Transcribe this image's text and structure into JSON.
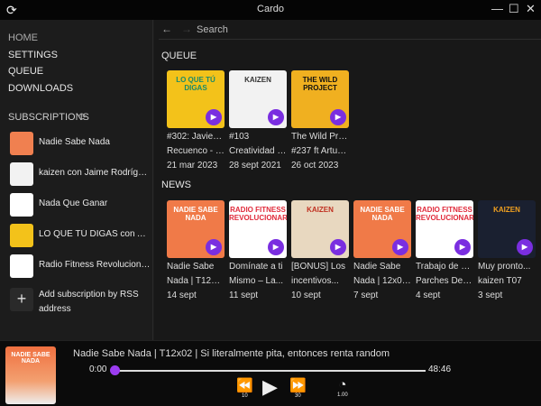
{
  "window": {
    "title": "Cardo",
    "sync_icon": "sync-icon"
  },
  "nav": [
    "HOME",
    "SETTINGS",
    "QUEUE",
    "DOWNLOADS"
  ],
  "subscriptions": {
    "heading": "SUBSCRIPTIONS",
    "items": [
      {
        "name": "Nadie Sabe Nada",
        "color": "#f08050"
      },
      {
        "name": "kaizen con Jaime Rodríguez de Santiago",
        "color": "#f2f2f2"
      },
      {
        "name": "Nada Que Ganar",
        "color": "#ffffff"
      },
      {
        "name": "LO QUE TÚ DIGAS con Alex Fidalgo",
        "color": "#f3c21a"
      },
      {
        "name": "Radio Fitness Revolucionario",
        "color": "#ffffff"
      }
    ],
    "add_label": "Add subscription by RSS address"
  },
  "search": {
    "placeholder": "Search"
  },
  "queue": {
    "heading": "QUEUE",
    "items": [
      {
        "l1": "#302: Javier G.",
        "l2": "Recuenco - La...",
        "date": "21 mar 2023",
        "art": "LO QUE TÚ DIGAS",
        "bg": "#f3c21a",
        "fg": "#1a8a6a"
      },
      {
        "l1": "#103",
        "l2": "Creatividad (I):...",
        "date": "28 sept 2021",
        "art": "KAIZEN",
        "bg": "#f2f2f2",
        "fg": "#333"
      },
      {
        "l1": "The Wild Project",
        "l2": "#237 ft Arturo...",
        "date": "26 oct 2023",
        "art": "THE WILD PROJECT",
        "bg": "#f0b020",
        "fg": "#111"
      }
    ]
  },
  "news": {
    "heading": "NEWS",
    "items": [
      {
        "l1": "Nadie Sabe",
        "l2": "Nada | T12x02 ...",
        "date": "14 sept",
        "art": "NADIE SABE NADA",
        "bg": "#f07a48",
        "fg": "#fff"
      },
      {
        "l1": "Domínate a ti",
        "l2": "Mismo – La...",
        "date": "11 sept",
        "art": "RADIO FITNESS REVOLUCIONARIO",
        "bg": "#ffffff",
        "fg": "#e02a3a"
      },
      {
        "l1": "[BONUS] Los",
        "l2": "incentivos...",
        "date": "10 sept",
        "art": "KAIZEN",
        "bg": "#e8d8c0",
        "fg": "#c03020"
      },
      {
        "l1": "Nadie Sabe",
        "l2": "Nada | 12x01 |...",
        "date": "7 sept",
        "art": "NADIE SABE NADA",
        "bg": "#f07a48",
        "fg": "#fff"
      },
      {
        "l1": "Trabajo de Core,",
        "l2": "Parches Detox,...",
        "date": "4 sept",
        "art": "RADIO FITNESS REVOLUCIONARIO",
        "bg": "#ffffff",
        "fg": "#e02a3a"
      },
      {
        "l1": "Muy pronto...",
        "l2": "kaizen T07",
        "date": "3 sept",
        "art": "KAIZEN",
        "bg": "#1a2030",
        "fg": "#f0a020"
      }
    ]
  },
  "player": {
    "title": "Nadie Sabe Nada | T12x02 | Si literalmente pita, entonces renta random",
    "art": "NADIE SABE NADA",
    "position": "0:00",
    "duration": "48:46",
    "progress": 0,
    "rewind": "10",
    "forward": "30",
    "speed": "1.00",
    "accent": "#9b3cf0"
  }
}
